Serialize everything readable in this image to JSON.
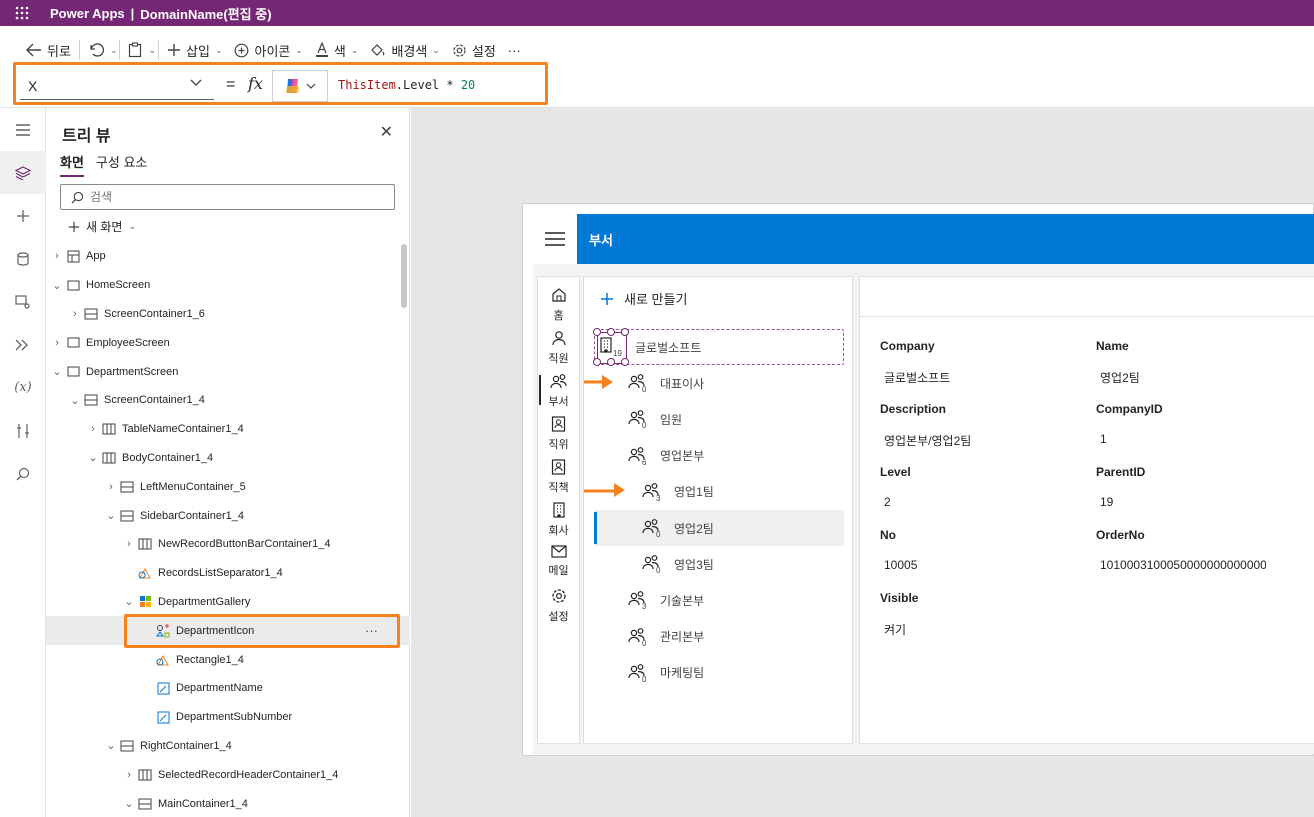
{
  "titlebar": {
    "app_name": "Power Apps",
    "separator": "|",
    "doc_name": "DomainName(편집 중)"
  },
  "toolbar": {
    "back": "뒤로",
    "insert": "삽입",
    "icons": "아이콘",
    "color": "색",
    "fill": "배경색",
    "settings": "설정",
    "more": "···"
  },
  "formula": {
    "property": "X",
    "equals": "=",
    "fx": "fx",
    "expr_kw": "ThisItem",
    "expr_rest": ".Level * ",
    "expr_num": "20"
  },
  "treeview": {
    "title": "트리 뷰",
    "tabs": [
      "화면",
      "구성 요소"
    ],
    "search_placeholder": "검색",
    "new_screen": "새 화면",
    "nodes": [
      {
        "label": "App",
        "expand": "›",
        "icon": "app-icon"
      },
      {
        "label": "HomeScreen",
        "expand": "⌄",
        "icon": "screen-icon"
      },
      {
        "label": "ScreenContainer1_6",
        "expand": "›",
        "icon": "horizontal-container-icon"
      },
      {
        "label": "EmployeeScreen",
        "expand": "›",
        "icon": "screen-icon"
      },
      {
        "label": "DepartmentScreen",
        "expand": "⌄",
        "icon": "screen-icon"
      },
      {
        "label": "ScreenContainer1_4",
        "expand": "⌄",
        "icon": "horizontal-container-icon"
      },
      {
        "label": "TableNameContainer1_4",
        "expand": "›",
        "icon": "vertical-container-icon"
      },
      {
        "label": "BodyContainer1_4",
        "expand": "⌄",
        "icon": "vertical-container-icon"
      },
      {
        "label": "LeftMenuContainer_5",
        "expand": "›",
        "icon": "horizontal-container-icon"
      },
      {
        "label": "SidebarContainer1_4",
        "expand": "⌄",
        "icon": "horizontal-container-icon"
      },
      {
        "label": "NewRecordButtonBarContainer1_4",
        "expand": "›",
        "icon": "vertical-container-icon"
      },
      {
        "label": "RecordsListSeparator1_4",
        "expand": "",
        "icon": "shape-icon"
      },
      {
        "label": "DepartmentGallery",
        "expand": "⌄",
        "icon": "gallery-icon"
      },
      {
        "label": "DepartmentIcon",
        "expand": "",
        "icon": "icon-control-icon",
        "more": "···"
      },
      {
        "label": "Rectangle1_4",
        "expand": "",
        "icon": "shape-icon"
      },
      {
        "label": "DepartmentName",
        "expand": "",
        "icon": "label-icon"
      },
      {
        "label": "DepartmentSubNumber",
        "expand": "",
        "icon": "label-icon"
      },
      {
        "label": "RightContainer1_4",
        "expand": "⌄",
        "icon": "horizontal-container-icon"
      },
      {
        "label": "SelectedRecordHeaderContainer1_4",
        "expand": "›",
        "icon": "vertical-container-icon"
      },
      {
        "label": "MainContainer1_4",
        "expand": "⌄",
        "icon": "horizontal-container-icon"
      }
    ]
  },
  "app": {
    "header_title": "부서",
    "menu": [
      {
        "label": "홈",
        "icon": "home-icon"
      },
      {
        "label": "직원",
        "icon": "person-icon"
      },
      {
        "label": "부서",
        "icon": "people-icon"
      },
      {
        "label": "직위",
        "icon": "contact-card-icon"
      },
      {
        "label": "직책",
        "icon": "contact-card-icon"
      },
      {
        "label": "회사",
        "icon": "building-icon"
      },
      {
        "label": "메일",
        "icon": "mail-icon"
      },
      {
        "label": "설정",
        "icon": "gear-icon"
      }
    ],
    "new_record": "새로 만들기",
    "gallery": [
      {
        "name": "글로벌소프트",
        "count": "19",
        "icon": "building-icon",
        "level": 0
      },
      {
        "name": "대표이사",
        "count": "0",
        "icon": "people-icon",
        "level": 1
      },
      {
        "name": "임원",
        "count": "0",
        "icon": "people-icon",
        "level": 1
      },
      {
        "name": "영업본부",
        "count": "6",
        "icon": "people-icon",
        "level": 1
      },
      {
        "name": "영업1팀",
        "count": "3",
        "icon": "people-icon",
        "level": 2
      },
      {
        "name": "영업2팀",
        "count": "0",
        "icon": "people-icon",
        "level": 2
      },
      {
        "name": "영업3팀",
        "count": "0",
        "icon": "people-icon",
        "level": 2
      },
      {
        "name": "기술본부",
        "count": "3",
        "icon": "people-icon",
        "level": 1
      },
      {
        "name": "관리본부",
        "count": "0",
        "icon": "people-icon",
        "level": 1
      },
      {
        "name": "마케팅팀",
        "count": "0",
        "icon": "people-icon",
        "level": 1
      }
    ],
    "selected_index": 5,
    "fields": [
      {
        "label": "Company",
        "value": "글로벌소프트"
      },
      {
        "label": "Name",
        "value": "영업2팀"
      },
      {
        "label": "Description",
        "value": "영업본부/영업2팀"
      },
      {
        "label": "CompanyID",
        "value": "1"
      },
      {
        "label": "Level",
        "value": "2"
      },
      {
        "label": "ParentID",
        "value": "19"
      },
      {
        "label": "No",
        "value": "10005"
      },
      {
        "label": "OrderNo",
        "value": "10100031000500000000000000"
      },
      {
        "label": "Visible",
        "value": "켜기"
      }
    ]
  },
  "colors": {
    "brand": "#742774",
    "accent": "#0078d4",
    "highlight": "#f7821b"
  }
}
